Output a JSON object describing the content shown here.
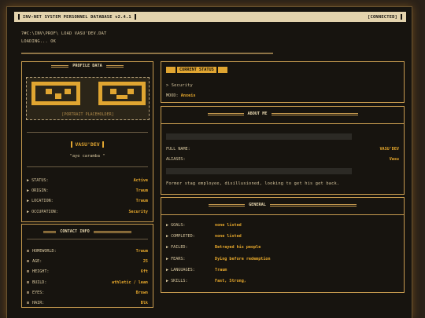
{
  "window": {
    "title": "INV-NET SYSTEM PERSONNEL DATABASE v2.4.1",
    "connection": "[CONNECTED]"
  },
  "terminal": {
    "line1": "7#C:\\INV\\PROF\\ LOAD VASU'DEV.DAT",
    "line2": "LOADING... OK",
    "progress": 1.0
  },
  "profile": {
    "title": "PROFILE DATA",
    "portrait_caption": "[PORTRAIT PLACEHOLDER]",
    "callsign": "VASU'DEV",
    "quote": "\"aye caramba \"",
    "fields": [
      {
        "label": "STATUS:",
        "value": "Active"
      },
      {
        "label": "ORIGIN:",
        "value": "Traum"
      },
      {
        "label": "LOCATION:",
        "value": "Traum"
      },
      {
        "label": "OCCUPATION:",
        "value": "Security"
      }
    ]
  },
  "contact": {
    "title": "CONTACT INFO",
    "fields": [
      {
        "label": "HOMEWORLD:",
        "value": "Traum"
      },
      {
        "label": "AGE:",
        "value": "25"
      },
      {
        "label": "HEIGHT:",
        "value": "6ft"
      },
      {
        "label": "BUILD:",
        "value": "athletic / lean"
      },
      {
        "label": "EYES:",
        "value": "Brown"
      },
      {
        "label": "HAIR:",
        "value": "Blk"
      }
    ]
  },
  "current_status": {
    "title": "CURRENT STATUS",
    "assignment": "> Security",
    "mood_label": "MOOD:",
    "mood_value": "Anxeis"
  },
  "about": {
    "title": "ABOUT ME",
    "full_name_label": "FULL NAME:",
    "full_name_value": "VASU'DEV",
    "aliases_label": "ALIASES:",
    "aliases_value": "Vasu",
    "bio": "Former stag employee, disillusioned, looking to get his get back."
  },
  "general": {
    "title": "GENERAL",
    "fields": [
      {
        "label": "GOALS:",
        "value": "none listed"
      },
      {
        "label": "COMPLETED:",
        "value": "none listed"
      },
      {
        "label": "FAILED:",
        "value": "Betrayed his people"
      },
      {
        "label": "FEARS:",
        "value": "Dying before redemption"
      },
      {
        "label": "LANGUAGES:",
        "value": "Traum"
      },
      {
        "label": "SKILLS:",
        "value": "Fast, Strong,"
      }
    ]
  },
  "colors": {
    "accent": "#e0a531",
    "border": "#c69a4f",
    "background": "#17140f",
    "titlebar": "#e3d3ad"
  }
}
